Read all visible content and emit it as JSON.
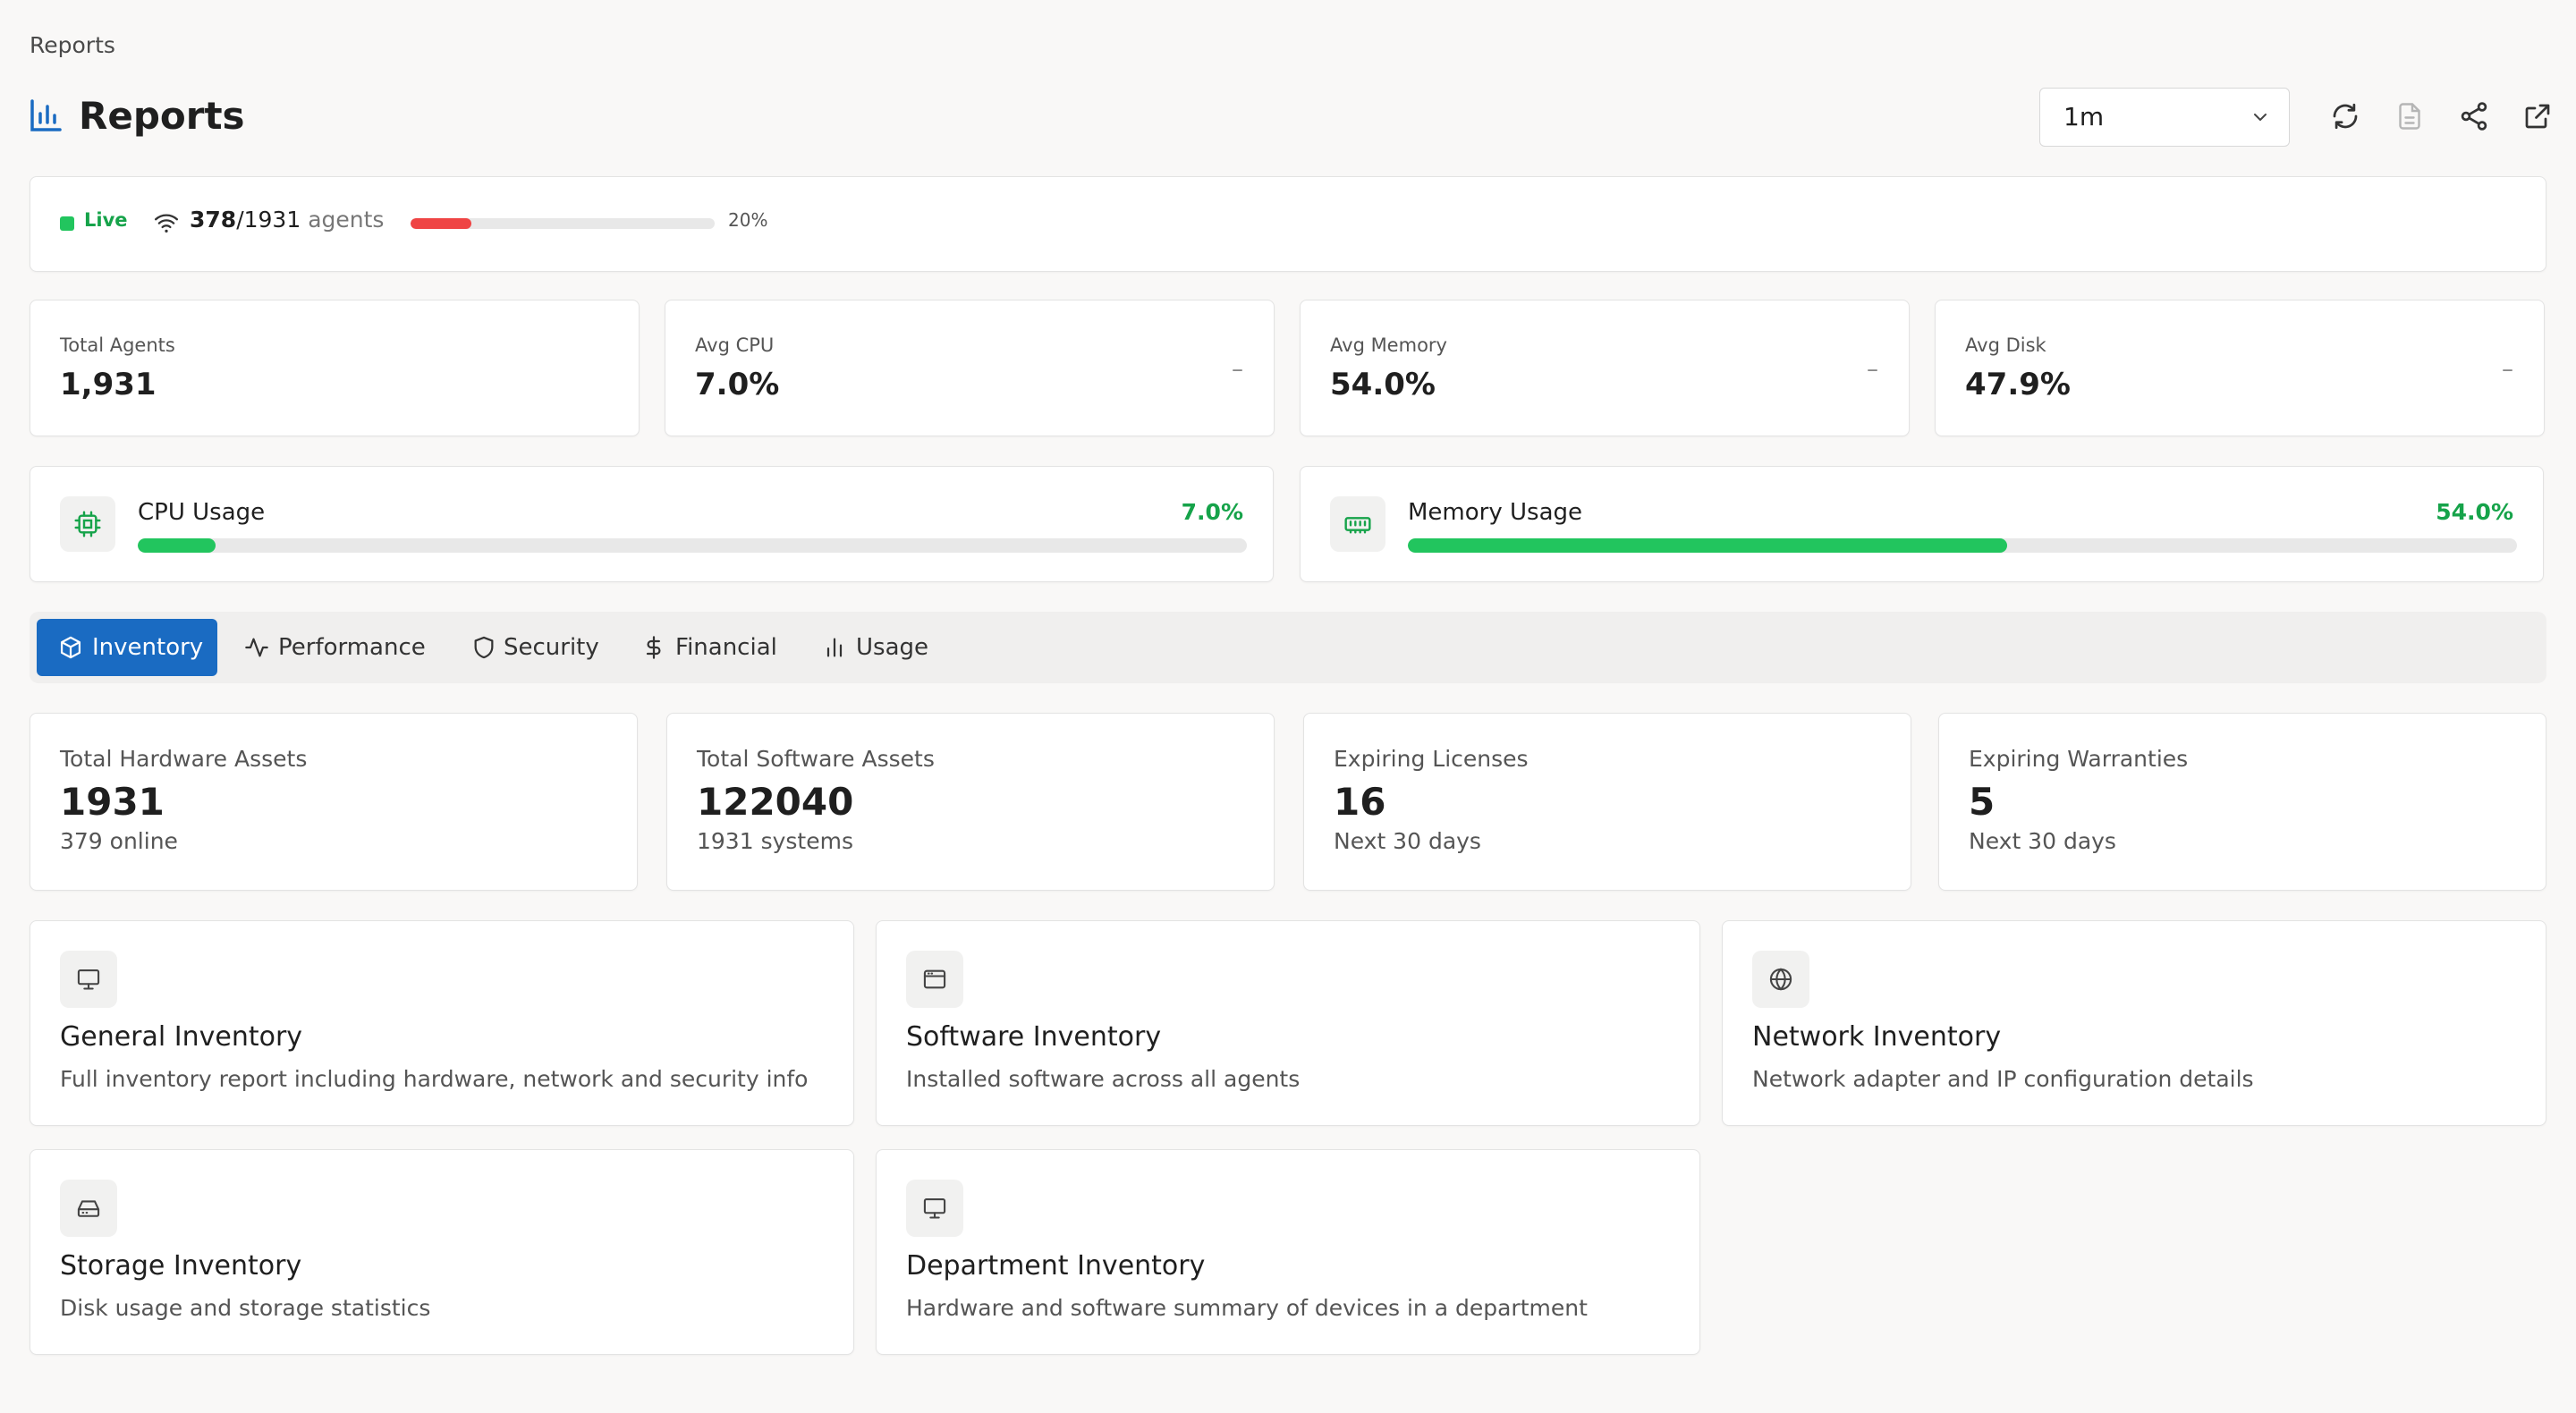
{
  "breadcrumb": "Reports",
  "page_title": "Reports",
  "toolbar": {
    "range_value": "1m"
  },
  "live_status": {
    "label": "Live",
    "online": "378",
    "total": "/1931",
    "unit": "agents",
    "percent_label": "20%",
    "percent": 0.2
  },
  "stats": [
    {
      "label": "Total Agents",
      "value": "1,931",
      "trend": ""
    },
    {
      "label": "Avg CPU",
      "value": "7.0%",
      "trend": "–"
    },
    {
      "label": "Avg Memory",
      "value": "54.0%",
      "trend": "–"
    },
    {
      "label": "Avg Disk",
      "value": "47.9%",
      "trend": "–"
    }
  ],
  "usage": {
    "cpu": {
      "label": "CPU Usage",
      "value": "7.0%",
      "fraction": 0.07
    },
    "memory": {
      "label": "Memory Usage",
      "value": "54.0%",
      "fraction": 0.54
    }
  },
  "tabs": [
    {
      "label": "Inventory",
      "icon": "box-icon",
      "active": true
    },
    {
      "label": "Performance",
      "icon": "activity-icon",
      "active": false
    },
    {
      "label": "Security",
      "icon": "shield-icon",
      "active": false
    },
    {
      "label": "Financial",
      "icon": "dollar-icon",
      "active": false
    },
    {
      "label": "Usage",
      "icon": "bar-chart-icon",
      "active": false
    }
  ],
  "inventory_stats": [
    {
      "label": "Total Hardware Assets",
      "value": "1931",
      "sub": "379 online"
    },
    {
      "label": "Total Software Assets",
      "value": "122040",
      "sub": "1931 systems"
    },
    {
      "label": "Expiring Licenses",
      "value": "16",
      "sub": "Next 30 days"
    },
    {
      "label": "Expiring Warranties",
      "value": "5",
      "sub": "Next 30 days"
    }
  ],
  "reports": [
    {
      "title": "General Inventory",
      "desc": "Full inventory report including hardware, network and security info",
      "icon": "monitor-icon"
    },
    {
      "title": "Software Inventory",
      "desc": "Installed software across all agents",
      "icon": "app-window-icon"
    },
    {
      "title": "Network Inventory",
      "desc": "Network adapter and IP configuration details",
      "icon": "globe-icon"
    },
    {
      "title": "Storage Inventory",
      "desc": "Disk usage and storage statistics",
      "icon": "hard-drive-icon"
    },
    {
      "title": "Department Inventory",
      "desc": "Hardware and software summary of devices in a department",
      "icon": "monitor-icon"
    }
  ],
  "colors": {
    "accent": "#1a6bc2",
    "live": "#22c55e",
    "danger": "#ef4444",
    "success_text": "#16a34a"
  }
}
